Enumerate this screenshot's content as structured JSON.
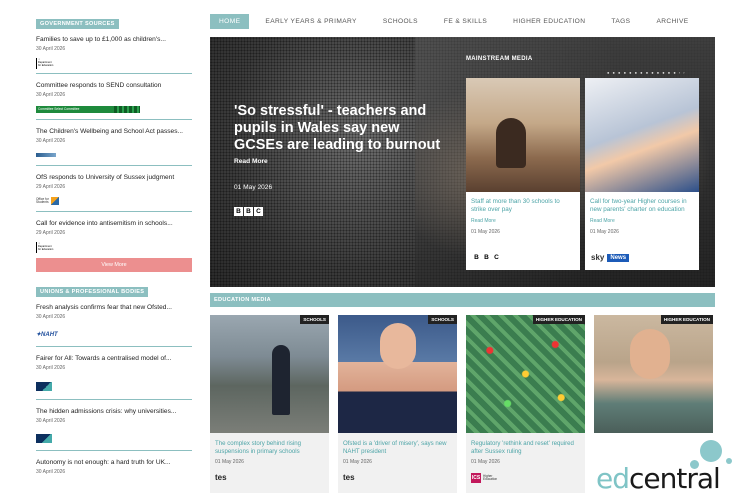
{
  "nav": {
    "items": [
      "HOME",
      "EARLY YEARS & PRIMARY",
      "SCHOOLS",
      "FE & SKILLS",
      "HIGHER EDUCATION",
      "TAGS",
      "ARCHIVE"
    ]
  },
  "sidebar": {
    "gov_header": "GOVERNMENT SOURCES",
    "gov_items": [
      {
        "title": "Families to save up to £1,000 as children's...",
        "date": "30 April 2026",
        "logo": "Department for Education"
      },
      {
        "title": "Committee responds to SEND consultation",
        "date": "30 April 2026",
        "logo": "Committee Select Committee"
      },
      {
        "title": "The Children's Wellbeing and School Act passes...",
        "date": "30 April 2026",
        "logo": "gov-wide"
      },
      {
        "title": "OfS responds to University of Sussex judgment",
        "date": "29 April 2026",
        "logo": "Office for Students"
      },
      {
        "title": "Call for evidence into antisemitism in schools...",
        "date": "29 April 2026",
        "logo": "Department for Education"
      }
    ],
    "view_more": "View More",
    "unions_header": "UNIONS & PROFESSIONAL BODIES",
    "union_items": [
      {
        "title": "Fresh analysis confirms fear that new Ofsted...",
        "date": "30 April 2026",
        "logo": "NAHT"
      },
      {
        "title": "Fairer for All: Towards a centralised model of...",
        "date": "30 April 2026",
        "logo": "edu"
      },
      {
        "title": "The hidden admissions crisis: why universities...",
        "date": "30 April 2026",
        "logo": "edu"
      },
      {
        "title": "Autonomy is not enough: a hard truth for UK...",
        "date": "30 April 2026",
        "logo": ""
      }
    ]
  },
  "hero": {
    "title": "'So stressful' - teachers and pupils in Wales say new GCSEs are leading to burnout",
    "read_more": "Read More",
    "date": "01 May 2026",
    "source": "BBC",
    "mainstream_label": "MAINSTREAM MEDIA",
    "cards": [
      {
        "title": "Staff at more than 30 schools to strike over pay",
        "read_more": "Read More",
        "date": "01 May 2026",
        "source": "BBC"
      },
      {
        "title": "Call for two-year Higher courses in new parents' charter on education",
        "read_more": "Read More",
        "date": "01 May 2026",
        "source": "sky News"
      }
    ]
  },
  "education_media": {
    "label": "EDUCATION MEDIA",
    "cards": [
      {
        "tag": "SCHOOLS",
        "title": "The complex story behind rising suspensions in primary schools",
        "date": "01 May 2026",
        "source": "tes"
      },
      {
        "tag": "SCHOOLS",
        "title": "Ofsted is a 'driver of misery', says new NAHT president",
        "date": "01 May 2026",
        "source": "tes"
      },
      {
        "tag": "HIGHER EDUCATION",
        "title": "Regulatory 'rethink and reset' required after Sussex ruling",
        "date": "01 May 2026",
        "source": "ICS"
      },
      {
        "tag": "HIGHER EDUCATION",
        "title": "",
        "date": "",
        "source": ""
      }
    ]
  },
  "brand": {
    "ed": "ed",
    "central": "central"
  },
  "colors": {
    "accent": "#8cbfc0",
    "link": "#4da4a7",
    "view_more": "#ec8f8f"
  }
}
